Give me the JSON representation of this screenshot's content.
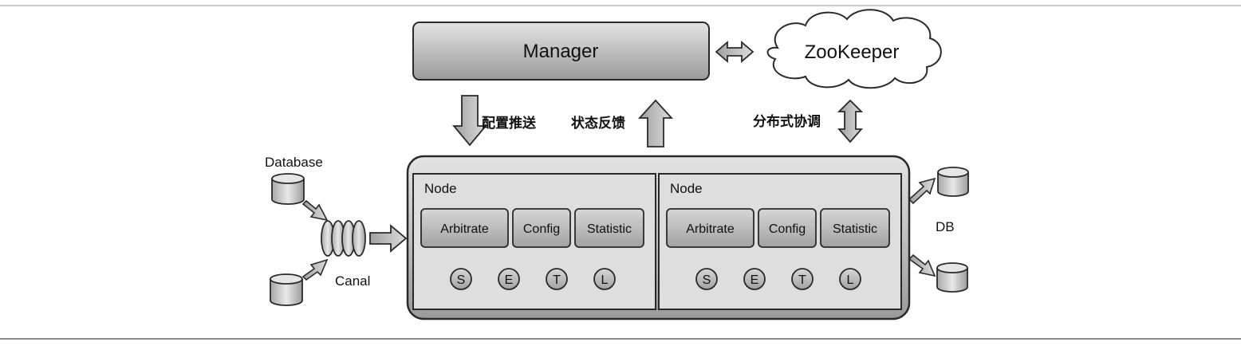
{
  "manager": {
    "label": "Manager"
  },
  "zookeeper": {
    "label": "ZooKeeper"
  },
  "flows": {
    "config_push": "配置推送",
    "status_feedback": "状态反馈",
    "distributed_coordination": "分布式协调"
  },
  "source": {
    "database_label": "Database",
    "canal_label": "Canal"
  },
  "target": {
    "db_label": "DB"
  },
  "nodes": [
    {
      "title": "Node",
      "modules": [
        "Arbitrate",
        "Config",
        "Statistic"
      ],
      "stages": [
        "S",
        "E",
        "T",
        "L"
      ]
    },
    {
      "title": "Node",
      "modules": [
        "Arbitrate",
        "Config",
        "Statistic"
      ],
      "stages": [
        "S",
        "E",
        "T",
        "L"
      ]
    }
  ],
  "colors": {
    "box_fill": "#d2d2d2",
    "box_dark": "#8c8c8c",
    "stroke": "#2a2a2a",
    "node_fill": "#e6e6e6",
    "module_fill": "#bcbcbc"
  }
}
